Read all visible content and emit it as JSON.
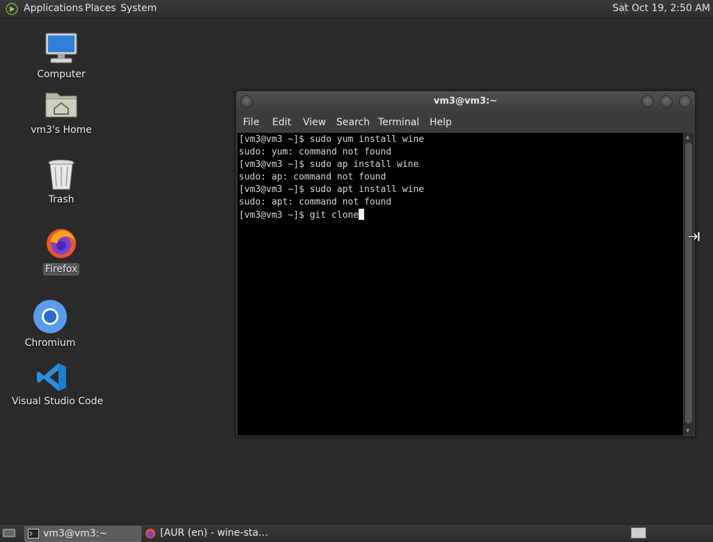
{
  "top_panel": {
    "menu": [
      "Applications",
      "Places",
      "System"
    ],
    "clock": "Sat Oct 19,  2:50 AM"
  },
  "desktop": {
    "icons": [
      {
        "label": "Computer",
        "icon": "computer-icon"
      },
      {
        "label": "vm3's Home",
        "icon": "home-folder-icon"
      },
      {
        "label": "Trash",
        "icon": "trash-icon"
      },
      {
        "label": "Firefox",
        "icon": "firefox-icon",
        "selected": true
      },
      {
        "label": "Chromium",
        "icon": "chromium-icon"
      },
      {
        "label": "Visual Studio Code",
        "icon": "vscode-icon"
      }
    ]
  },
  "terminal": {
    "title": "vm3@vm3:~",
    "menu": [
      "File",
      "Edit",
      "View",
      "Search",
      "Terminal",
      "Help"
    ],
    "lines": [
      "[vm3@vm3 ~]$ sudo yum install wine",
      "sudo: yum: command not found",
      "[vm3@vm3 ~]$ sudo ap install wine",
      "sudo: ap: command not found",
      "[vm3@vm3 ~]$ sudo apt install wine",
      "sudo: apt: command not found"
    ],
    "current_input": "[vm3@vm3 ~]$ git clone"
  },
  "taskbar": {
    "tasks": [
      {
        "label": "vm3@vm3:~",
        "icon": "terminal-icon",
        "active": true
      },
      {
        "label": "[AUR (en) - wine-sta…",
        "icon": "firefox-icon",
        "active": false
      }
    ]
  },
  "colors": {
    "desktop_bg": "#2b2b2b",
    "terminal_bg": "#000000",
    "panel_bg": "#3a3a3a"
  }
}
